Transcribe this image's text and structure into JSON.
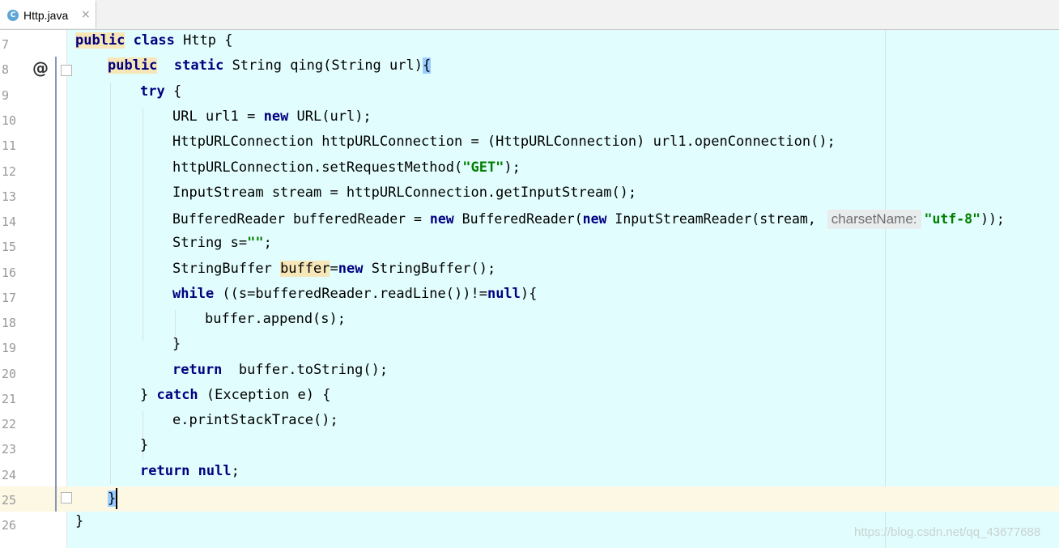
{
  "tab": {
    "icon_letter": "C",
    "label": "Http.java",
    "close": "×"
  },
  "line_numbers": [
    "7",
    "8",
    "9",
    "10",
    "11",
    "12",
    "13",
    "14",
    "15",
    "16",
    "17",
    "18",
    "19",
    "20",
    "21",
    "22",
    "23",
    "24",
    "25",
    "26"
  ],
  "gutter_marker": "@",
  "code": {
    "l7": {
      "kw1": "public",
      "kw2": "class",
      "rest": " Http {"
    },
    "l8": {
      "kw1": "public",
      "kw2": "static",
      "mid": " String qing(String url)",
      "brace": "{"
    },
    "l9": {
      "kw": "try",
      "rest": " {"
    },
    "l10": {
      "pre": "URL url1 = ",
      "kw": "new",
      "post": " URL(url);"
    },
    "l11": {
      "text": "HttpURLConnection httpURLConnection = (HttpURLConnection) url1.openConnection();"
    },
    "l12": {
      "pre": "httpURLConnection.setRequestMethod(",
      "str": "\"GET\"",
      "post": ");"
    },
    "l13": {
      "text": "InputStream stream = httpURLConnection.getInputStream();"
    },
    "l14": {
      "pre": "BufferedReader bufferedReader = ",
      "kw1": "new",
      "mid": " BufferedReader(",
      "kw2": "new",
      "mid2": " InputStreamReader(stream, ",
      "hint": "charsetName:",
      "str": "\"utf-8\"",
      "post": "));"
    },
    "l15": {
      "pre": "String s=",
      "str": "\"\"",
      "post": ";"
    },
    "l16": {
      "pre": "StringBuffer ",
      "var": "buffer",
      "eq": "=",
      "kw": "new",
      "post": " StringBuffer();"
    },
    "l17": {
      "kw": "while",
      "mid": " ((s=bufferedReader.readLine())!=",
      "kw2": "null",
      "post": "){"
    },
    "l18": {
      "text": "buffer.append(s);"
    },
    "l19": {
      "text": "}"
    },
    "l20": {
      "kw": "return",
      "post": "  buffer.toString();"
    },
    "l21": {
      "pre": "} ",
      "kw": "catch",
      "post": " (Exception e) {"
    },
    "l22": {
      "text": "e.printStackTrace();"
    },
    "l23": {
      "text": "}"
    },
    "l24": {
      "kw": "return",
      "sp": " ",
      "kw2": "null",
      "post": ";"
    },
    "l25": {
      "brace": "}"
    },
    "l26": {
      "text": "}"
    }
  },
  "watermark": "https://blog.csdn.net/qq_43677688"
}
